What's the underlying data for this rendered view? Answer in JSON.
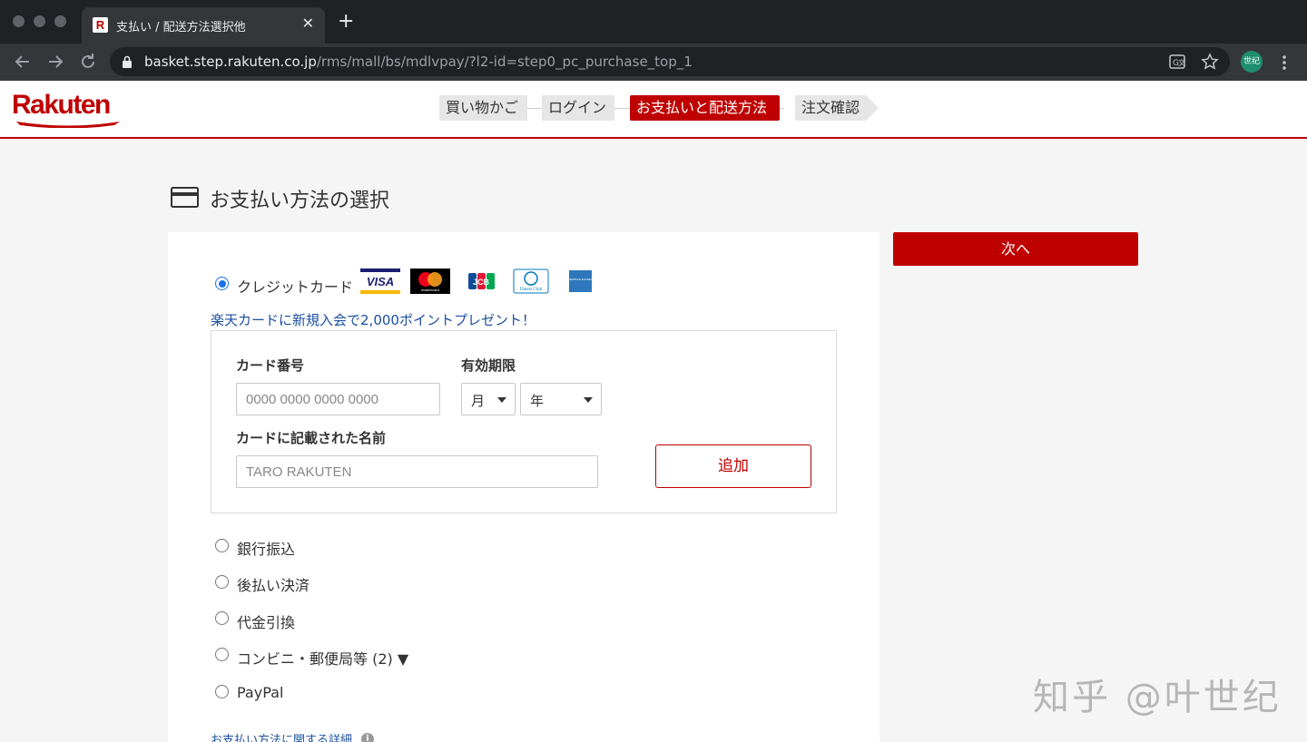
{
  "browser": {
    "tab_title": "支払い / 配送方法選択他",
    "tab_favicon": "R",
    "url_host": "basket.step.rakuten.co.jp",
    "url_path": "/rms/mall/bs/mdlvpay/?l2-id=step0_pc_purchase_top_1",
    "profile_label": "世纪"
  },
  "header": {
    "logo": "Rakuten",
    "steps": [
      {
        "label": "買い物かご",
        "active": false
      },
      {
        "label": "ログイン",
        "active": false
      },
      {
        "label": "お支払いと配送方法",
        "active": true
      },
      {
        "label": "注文確認",
        "active": false
      }
    ]
  },
  "payment": {
    "title": "お支払い方法の選択",
    "credit_label": "クレジットカード",
    "brands": [
      "VISA",
      "mastercard",
      "JCB",
      "Diners Club",
      "AMERICAN EXPRESS"
    ],
    "promo_link": "楽天カードに新規入会で2,000ポイントプレゼント！",
    "card_number_label": "カード番号",
    "card_number_placeholder": "0000 0000 0000 0000",
    "expiry_label": "有効期限",
    "month_value": "月",
    "year_value": "年",
    "name_label": "カードに記載された名前",
    "name_placeholder": "TARO RAKUTEN",
    "add_button": "追加",
    "other_methods": [
      "銀行振込",
      "後払い決済",
      "代金引換",
      "コンビニ・郵便局等 (2) ▼",
      "PayPal"
    ],
    "detail_link": "お支払い方法に関する詳細",
    "info_glyph": "i"
  },
  "sidebar": {
    "next_button": "次へ"
  },
  "watermark": "知乎 @叶世纪",
  "colors": {
    "brand_red": "#bf0000",
    "link_blue": "#1a4fa0",
    "radio_blue": "#1a73e8"
  }
}
